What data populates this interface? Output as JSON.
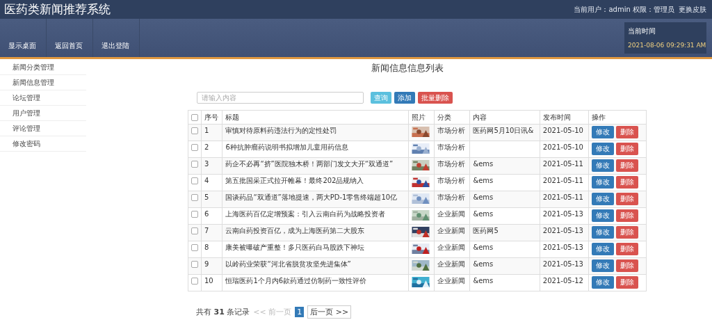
{
  "header": {
    "title": "医药类新闻推荐系统",
    "user_info": "当前用户：admin 权限：管理员",
    "skin_link": "更换皮肤"
  },
  "nav": [
    "显示桌面",
    "返回首页",
    "退出登陆"
  ],
  "clock": {
    "label": "当前时间",
    "value": "2021-08-06 09:29:31 AM"
  },
  "sidebar": {
    "items": [
      {
        "label": "新闻分类管理",
        "selected": false
      },
      {
        "label": "新闻信息管理",
        "selected": false
      },
      {
        "label": "论坛管理",
        "selected": false
      },
      {
        "label": "用户管理",
        "selected": false
      },
      {
        "label": "评论管理",
        "selected": false
      },
      {
        "label": "修改密码",
        "selected": false
      }
    ]
  },
  "page_title": "新闻信息信息列表",
  "search": {
    "placeholder": "请输入内容"
  },
  "toolbar": [
    "查询",
    "添加",
    "批量删除"
  ],
  "table": {
    "header_checked": false,
    "columns": [
      "序号",
      "标题",
      "照片",
      "分类",
      "内容",
      "发布时间",
      "操作"
    ],
    "rows": [
      {
        "checked": false,
        "no": "1",
        "title": "审慎对待原料药违法行为的定性处罚",
        "category": "市场分析",
        "content": "医药网5月10日讯&",
        "date": "2021-05-10",
        "actions": [
          "修改",
          "删除"
        ]
      },
      {
        "checked": false,
        "no": "2",
        "title": "6种抗肿瘤药说明书拟增加儿童用药信息",
        "category": "市场分析",
        "content": "",
        "date": "2021-05-10",
        "actions": [
          "修改",
          "删除"
        ]
      },
      {
        "checked": false,
        "no": "3",
        "title": "药企不必再“挤”医院独木桥！两部门发文大开“双通道”",
        "category": "市场分析",
        "content": "&ems",
        "date": "2021-05-11",
        "actions": [
          "修改",
          "删除"
        ]
      },
      {
        "checked": false,
        "no": "4",
        "title": "第五批国采正式拉开帷幕！最终202品规纳入",
        "category": "市场分析",
        "content": "&ems",
        "date": "2021-05-11",
        "actions": [
          "修改",
          "删除"
        ]
      },
      {
        "checked": false,
        "no": "5",
        "title": "国谈药品“双通道”落地提速，两大PD-1零售终端超10亿",
        "category": "市场分析",
        "content": "&ems",
        "date": "2021-05-11",
        "actions": [
          "修改",
          "删除"
        ]
      },
      {
        "checked": false,
        "no": "6",
        "title": "上海医药百亿定增预案：引入云南白药为战略投资者",
        "category": "企业新闻",
        "content": "&ems",
        "date": "2021-05-13",
        "actions": [
          "修改",
          "删除"
        ]
      },
      {
        "checked": false,
        "no": "7",
        "title": "云南白药投资百亿，成为上海医药第二大股东",
        "category": "企业新闻",
        "content": "医药网5",
        "date": "2021-05-13",
        "actions": [
          "修改",
          "删除"
        ]
      },
      {
        "checked": false,
        "no": "8",
        "title": "康美被曝破产重整！多只医药白马股跌下神坛",
        "category": "企业新闻",
        "content": "&ems",
        "date": "2021-05-13",
        "actions": [
          "修改",
          "删除"
        ]
      },
      {
        "checked": false,
        "no": "9",
        "title": "以岭药业荣获“河北省脱贫攻坚先进集体”",
        "category": "企业新闻",
        "content": "&ems",
        "date": "2021-05-13",
        "actions": [
          "修改",
          "删除"
        ]
      },
      {
        "checked": false,
        "no": "10",
        "title": "恒瑞医药1个月内6款药通过仿制药一致性评价",
        "category": "企业新闻",
        "content": "&ems",
        "date": "2021-05-12",
        "actions": [
          "修改",
          "删除"
        ]
      }
    ]
  },
  "pagination": {
    "summary": "共有 **31** 条记录",
    "prev": {
      "label": "<< 前一页",
      "disabled": true
    },
    "pages": [
      {
        "label": "1",
        "selected": true
      }
    ],
    "next": {
      "label": "后一页 >>",
      "disabled": false
    }
  }
}
